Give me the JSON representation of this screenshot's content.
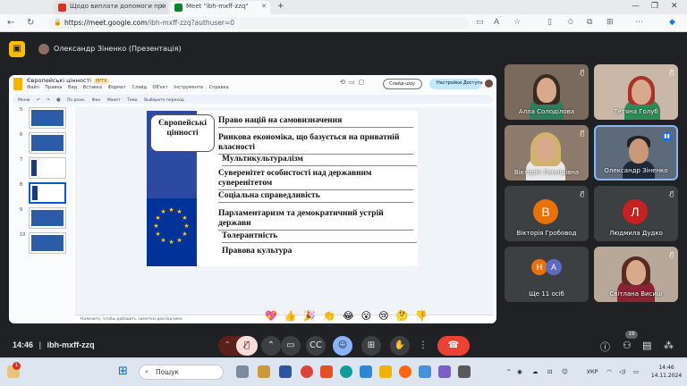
{
  "browser": {
    "tabs": [
      {
        "label": "Щодо виплати допомоги при п",
        "icon": "pdf-icon",
        "color": "#d93025"
      },
      {
        "label": "Meet \"ibh-mxff-zzq\"",
        "icon": "meet-icon",
        "color": "#00832d"
      }
    ],
    "url_host": "https://meet.google.com",
    "url_path": "/ibh-mxff-zzq?authuser=0"
  },
  "meet": {
    "presenter_label": "Олександр Зіненко (Презентація)",
    "time": "14:46",
    "separator": "|",
    "meeting_code": "ibh-mxff-zzq",
    "participant_count_badge": "19",
    "reactions": [
      "💖",
      "👍",
      "🎉",
      "👏",
      "😂",
      "😮",
      "😢",
      "🤔",
      "👎"
    ],
    "participants": [
      {
        "name": "Алла Солоділова",
        "type": "video"
      },
      {
        "name": "Тетяна Голуб",
        "type": "video"
      },
      {
        "name": "Вікторія Леонідівна",
        "type": "video"
      },
      {
        "name": "Олександр Зіненко",
        "type": "video"
      },
      {
        "name": "Вікторія Гробовод",
        "type": "avatar",
        "initial": "В",
        "color": "#e8710a"
      },
      {
        "name": "Людмила Дудко",
        "type": "avatar",
        "initial": "Л",
        "color": "#c5221f"
      },
      {
        "name": "Ще 11 осіб",
        "type": "more",
        "initials": [
          "Н",
          "А"
        ],
        "colors": [
          "#e8710a",
          "#5c6bc0"
        ]
      },
      {
        "name": "Світлана Висиці",
        "type": "video"
      }
    ]
  },
  "slides_app": {
    "title": "Європейські цінності",
    "badge": "PPTX",
    "menu": [
      "Файл",
      "Правка",
      "Вид",
      "Вставка",
      "Формат",
      "Слайд",
      "Об'єкт",
      "Інструменти",
      "Справка"
    ],
    "slideshow_label": "Слайд-шоу",
    "share_label": "Настройки Доступа",
    "toolbar": [
      "Меню",
      "↶",
      "↷",
      "🖶",
      "По разм.",
      "Фон",
      "Макет",
      "Тема",
      "Выберите переход"
    ],
    "speaker_notes": "Нажмите, чтобы добавить заметки докладчика",
    "thumb_numbers": [
      "5",
      "6",
      "7",
      "8",
      "9",
      "10"
    ]
  },
  "slide": {
    "title": "Європейські цінності",
    "items": [
      "Право націй на самовизначення",
      "Ринкова економіка, що базується на приватній власності",
      "Мультикультуралізм",
      "Суверенітет особистості над державним суверенітетом",
      "Соціальна справедливість",
      "Парламентаризм та демократичний устрій держави",
      "Толерантність",
      "Правова культура"
    ]
  },
  "taskbar": {
    "search_label": "Пошук",
    "notif_count": "1",
    "lang": "УКР",
    "time": "14:46",
    "date": "14.11.2024"
  },
  "colors": {
    "meet_bg": "#202124",
    "accent_blue": "#8ab4f8",
    "end_red": "#ea4335",
    "eu_blue": "#003399",
    "eu_gold": "#ffcc00"
  }
}
